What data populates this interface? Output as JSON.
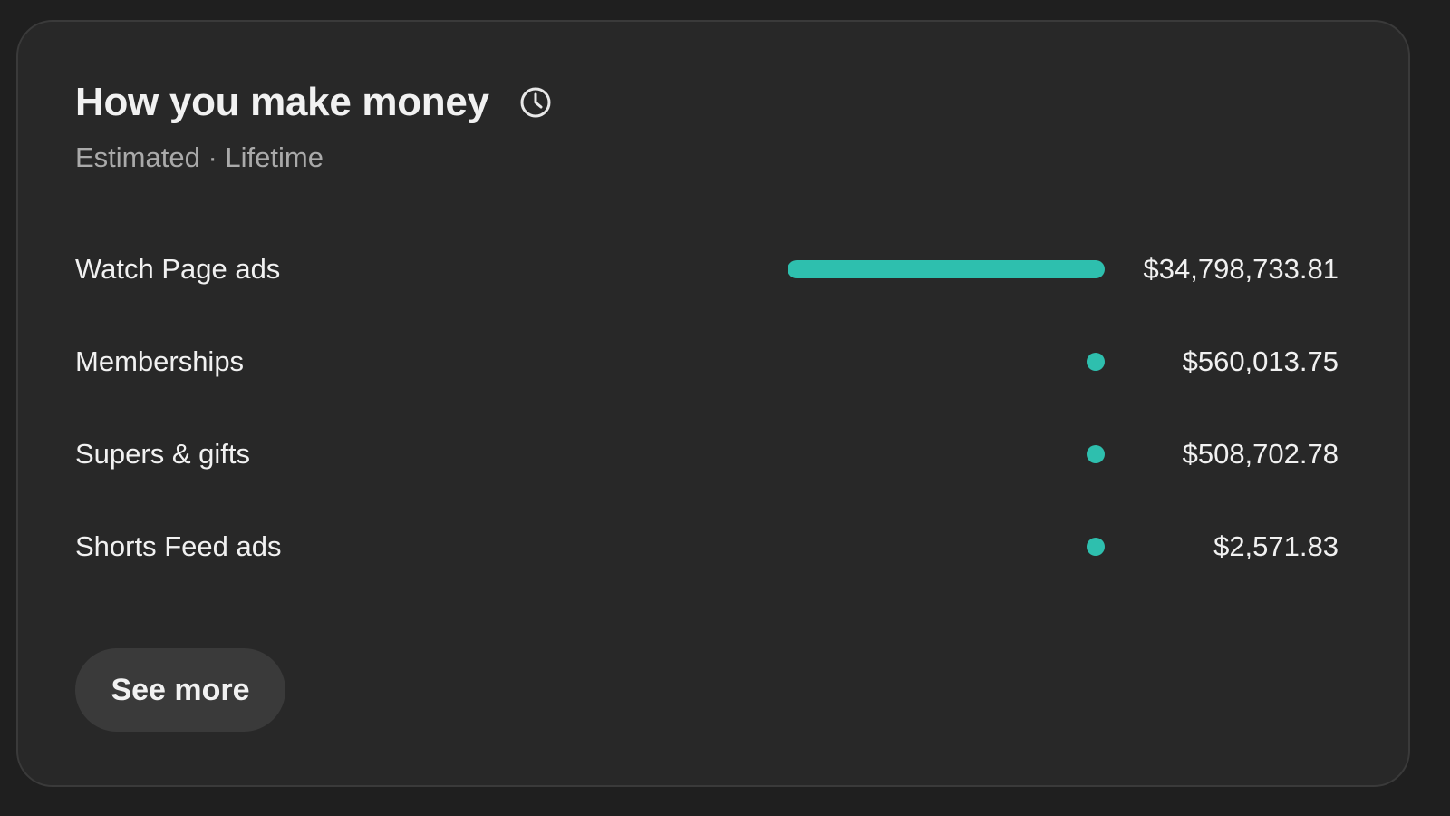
{
  "card": {
    "title": "How you make money",
    "subtitle": "Estimated · Lifetime",
    "history_icon": "history-icon",
    "accent_color": "#2ebfae",
    "see_more_label": "See more"
  },
  "chart_data": {
    "type": "bar",
    "categories": [
      "Watch Page ads",
      "Memberships",
      "Supers & gifts",
      "Shorts Feed ads"
    ],
    "values": [
      34798733.81,
      560013.75,
      508702.78,
      2571.83
    ],
    "value_labels": [
      "$34,798,733.81",
      "$560,013.75",
      "$508,702.78",
      "$2,571.83"
    ],
    "title": "How you make money",
    "subtitle": "Estimated · Lifetime",
    "xlabel": "",
    "ylabel": ""
  }
}
